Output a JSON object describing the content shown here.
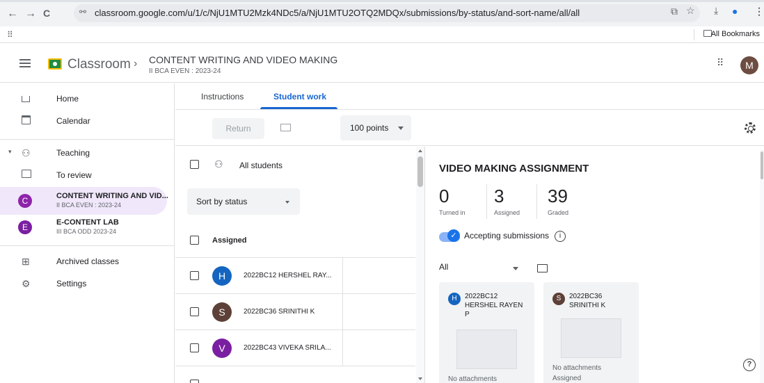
{
  "browser": {
    "url": "classroom.google.com/u/1/c/NjU1MTU2Mzk4NDc5/a/NjU1MTU2OTQ2MDQx/submissions/by-status/and-sort-name/all/all",
    "bookmarks_label": "All Bookmarks",
    "back_glyph": "←",
    "forward_glyph": "→",
    "reload_glyph": "C",
    "site_info_glyph": "⚯",
    "cast_glyph": "⧉",
    "star_glyph": "☆",
    "download_glyph": "⤓",
    "profile_glyph": "●",
    "menu_glyph": "⋮",
    "apps_glyph": "⠿"
  },
  "header": {
    "app_title": "Classroom",
    "chevron": "›",
    "class_name": "CONTENT WRITING AND VIDEO MAKING",
    "class_sub": "II BCA EVEN : 2023-24",
    "apps_glyph": "⠿",
    "avatar_letter": "M"
  },
  "sidebar": {
    "home": "Home",
    "calendar": "Calendar",
    "teaching_caret": "▾",
    "teaching_glyph": "⚇",
    "teaching": "Teaching",
    "to_review": "To review",
    "classes": [
      {
        "letter": "C",
        "name": "CONTENT WRITING AND VID...",
        "sub": "II BCA EVEN : 2023-24",
        "color": "#8e24aa"
      },
      {
        "letter": "E",
        "name": "E-CONTENT LAB",
        "sub": "III BCA ODD 2023-24",
        "color": "#7b1fa2"
      }
    ],
    "archived": "Archived classes",
    "archive_glyph": "⊞",
    "settings": "Settings",
    "settings_glyph": "⚙"
  },
  "tabs": {
    "instructions": "Instructions",
    "student_work": "Student work"
  },
  "toolbar": {
    "return_label": "Return",
    "points": "100 points"
  },
  "list": {
    "people_glyph": "⚇",
    "all_students": "All students",
    "sort_label": "Sort by status",
    "assigned_header": "Assigned",
    "students": [
      {
        "letter": "H",
        "name": "2022BC12 HERSHEL RAY...",
        "color": "#1565c0"
      },
      {
        "letter": "S",
        "name": "2022BC36 SRINITHI K",
        "color": "#5d4037"
      },
      {
        "letter": "V",
        "name": "2022BC43 VIVEKA SRILA...",
        "color": "#7b1fa2"
      }
    ]
  },
  "assignment": {
    "title": "VIDEO MAKING ASSIGNMENT",
    "turned_in": "0",
    "turned_in_label": "Turned in",
    "assigned": "3",
    "assigned_label": "Assigned",
    "graded": "39",
    "graded_label": "Graded",
    "toggle_check": "✓",
    "accepting": "Accepting submissions",
    "info_glyph": "i",
    "filter": "All",
    "cards": [
      {
        "letter": "H",
        "name": "2022BC12 HERSHEL RAYEN P",
        "attachments": "No attachments",
        "status": "",
        "color": "#1565c0"
      },
      {
        "letter": "S",
        "name": "2022BC36 SRINITHI K",
        "attachments": "No attachments",
        "status": "Assigned",
        "color": "#5d4037"
      }
    ],
    "help_glyph": "?"
  }
}
